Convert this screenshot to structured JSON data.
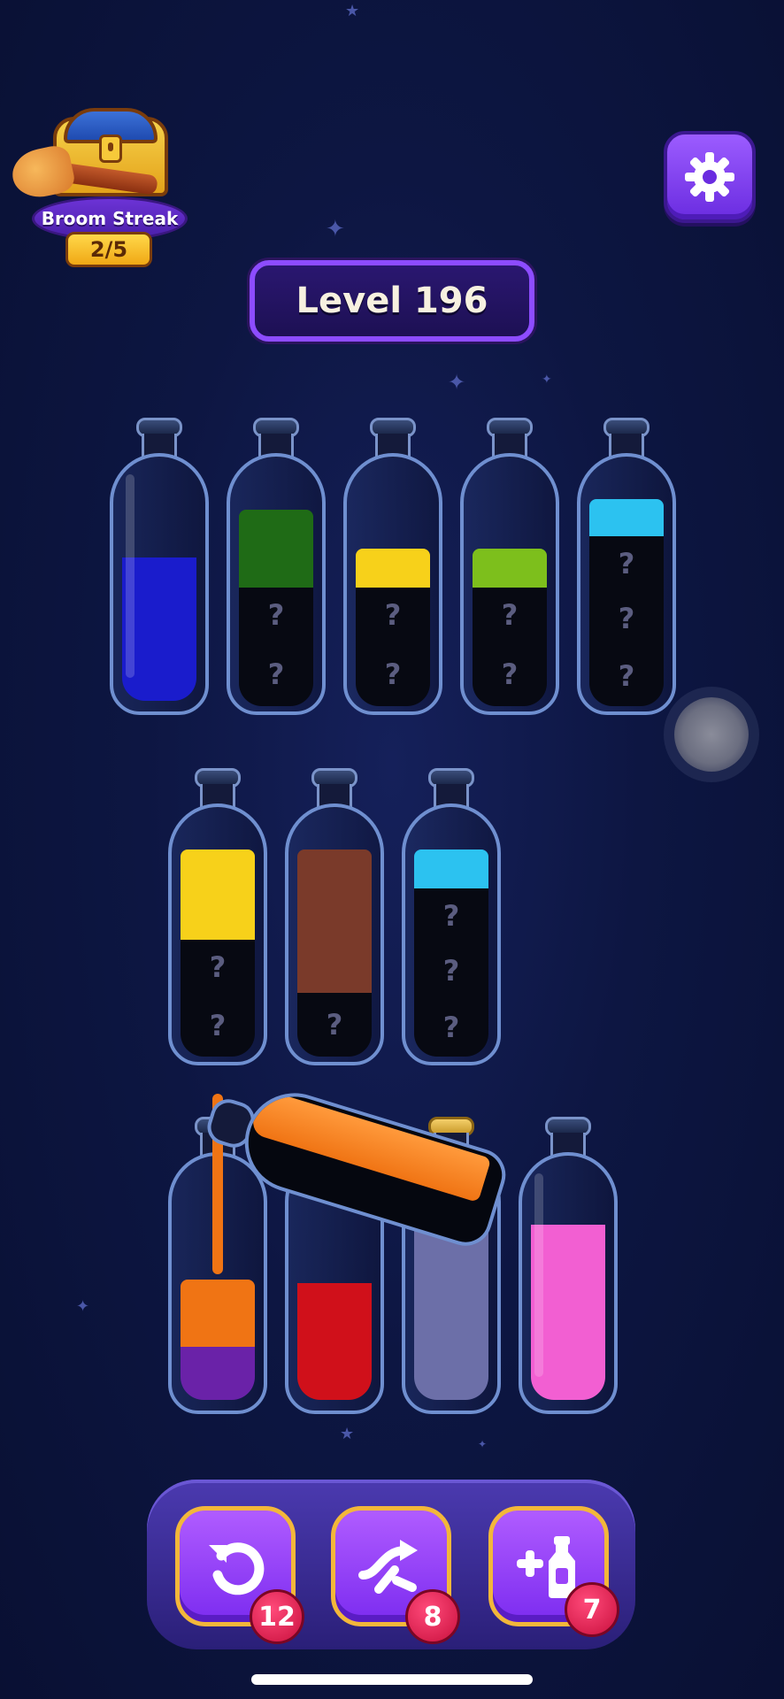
{
  "streak": {
    "label": "Broom Streak",
    "count": "2/5"
  },
  "level": {
    "label": "Level 196"
  },
  "bottles_row1": [
    {
      "layers": [
        "blue"
      ],
      "hidden": 0
    },
    {
      "layers": [
        "green"
      ],
      "hidden": 2
    },
    {
      "layers": [
        "yellow"
      ],
      "hidden": 2
    },
    {
      "layers": [
        "lime"
      ],
      "hidden": 2
    },
    {
      "layers": [
        "cyan"
      ],
      "hidden": 3
    }
  ],
  "bottles_row2": [
    {
      "layers": [
        "yellow"
      ],
      "hidden": 2
    },
    {
      "layers": [
        "brown"
      ],
      "hidden": 1
    },
    {
      "layers": [
        "cyan"
      ],
      "hidden": 3
    }
  ],
  "bottles_row3": [
    {
      "layers": [
        "orange",
        "purple"
      ]
    },
    {
      "layers": [
        "red"
      ]
    },
    {
      "layers": [
        "lavender"
      ]
    },
    {
      "layers": [
        "pink"
      ]
    }
  ],
  "colors": {
    "blue": "#1a1ccc",
    "green": "#1f6b16",
    "yellow": "#f7d11a",
    "lime": "#7dbf1c",
    "cyan": "#2cc2f0",
    "brown": "#7a3a2a",
    "orange": "#f07414",
    "purple": "#6a22a8",
    "red": "#d0101a",
    "lavender": "#6c6fa8",
    "pink": "#f25fd2",
    "accent": "#8d4cff",
    "gold": "#f3b73a"
  },
  "hidden_mark": "?",
  "toolbar": {
    "undo_count": "12",
    "shuffle_count": "8",
    "add_bottle_count": "7"
  }
}
